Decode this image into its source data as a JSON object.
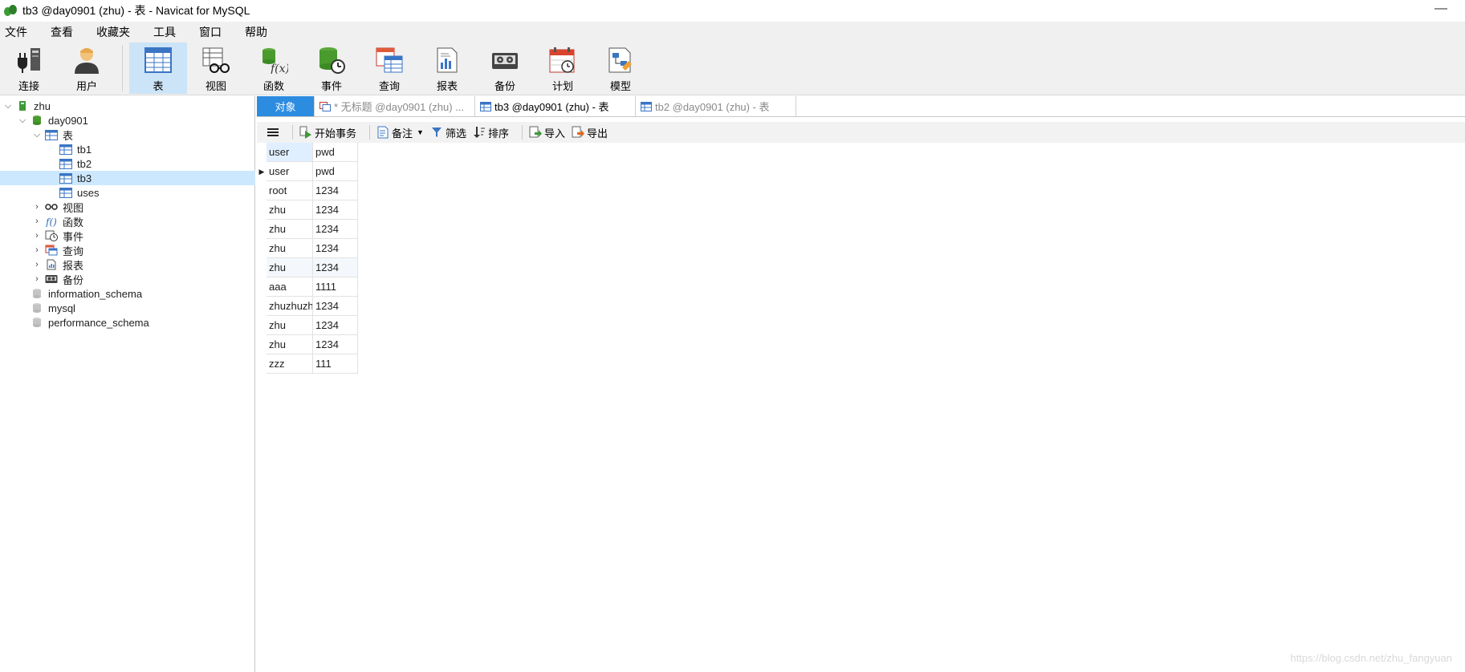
{
  "window": {
    "title": "tb3 @day0901 (zhu) - 表 - Navicat for MySQL",
    "minimize": "—"
  },
  "menu": [
    "文件",
    "查看",
    "收藏夹",
    "工具",
    "窗口",
    "帮助"
  ],
  "toolbar": [
    {
      "label": "连接",
      "icon": "connection-plug-icon"
    },
    {
      "label": "用户",
      "icon": "user-icon"
    },
    {
      "label": "表",
      "icon": "table-icon",
      "active": true
    },
    {
      "label": "视图",
      "icon": "view-glasses-icon"
    },
    {
      "label": "函数",
      "icon": "function-icon"
    },
    {
      "label": "事件",
      "icon": "event-clock-icon"
    },
    {
      "label": "查询",
      "icon": "query-icon"
    },
    {
      "label": "报表",
      "icon": "report-icon"
    },
    {
      "label": "备份",
      "icon": "backup-icon"
    },
    {
      "label": "计划",
      "icon": "schedule-calendar-icon"
    },
    {
      "label": "模型",
      "icon": "model-icon"
    }
  ],
  "tree": [
    {
      "label": "zhu",
      "level": 0,
      "arrow": "⌵",
      "icon": "connection-icon"
    },
    {
      "label": "day0901",
      "level": 1,
      "arrow": "⌵",
      "icon": "database-icon"
    },
    {
      "label": "表",
      "level": 2,
      "arrow": "⌵",
      "icon": "table-icon"
    },
    {
      "label": "tb1",
      "level": 3,
      "arrow": "",
      "icon": "table-icon"
    },
    {
      "label": "tb2",
      "level": 3,
      "arrow": "",
      "icon": "table-icon"
    },
    {
      "label": "tb3",
      "level": 3,
      "arrow": "",
      "icon": "table-icon",
      "selected": true
    },
    {
      "label": "uses",
      "level": 3,
      "arrow": "",
      "icon": "table-icon"
    },
    {
      "label": "视图",
      "level": 2,
      "arrow": "›",
      "icon": "view-glasses-icon"
    },
    {
      "label": "函数",
      "level": 2,
      "arrow": "›",
      "icon": "function-icon"
    },
    {
      "label": "事件",
      "level": 2,
      "arrow": "›",
      "icon": "event-clock-icon"
    },
    {
      "label": "查询",
      "level": 2,
      "arrow": "›",
      "icon": "query-icon"
    },
    {
      "label": "报表",
      "level": 2,
      "arrow": "›",
      "icon": "report-icon"
    },
    {
      "label": "备份",
      "level": 2,
      "arrow": "›",
      "icon": "backup-icon"
    },
    {
      "label": "information_schema",
      "level": 1,
      "arrow": "",
      "icon": "database-gray-icon"
    },
    {
      "label": "mysql",
      "level": 1,
      "arrow": "",
      "icon": "database-gray-icon"
    },
    {
      "label": "performance_schema",
      "level": 1,
      "arrow": "",
      "icon": "database-gray-icon"
    }
  ],
  "tabs": {
    "objects": "对象",
    "items": [
      {
        "label": "* 无标题 @day0901 (zhu) ...",
        "state": "inactive",
        "icon": "query-icon"
      },
      {
        "label": "tb3 @day0901 (zhu) - 表",
        "state": "current",
        "icon": "table-icon"
      },
      {
        "label": "tb2 @day0901 (zhu) - 表",
        "state": "inactive",
        "icon": "table-icon"
      }
    ]
  },
  "subtoolbar": {
    "menu_icon": "hamburger-menu-icon",
    "begin_transaction": "开始事务",
    "memo": "备注",
    "filter": "筛选",
    "sort": "排序",
    "import": "导入",
    "export": "导出"
  },
  "grid": {
    "columns": [
      "user",
      "pwd"
    ],
    "rows": [
      [
        "user",
        "pwd"
      ],
      [
        "root",
        "1234"
      ],
      [
        "zhu",
        "1234"
      ],
      [
        "zhu",
        "1234"
      ],
      [
        "zhu",
        "1234"
      ],
      [
        "zhu",
        "1234"
      ],
      [
        "aaa",
        "1111"
      ],
      [
        "zhuzhuzhu",
        "1234"
      ],
      [
        "zhu",
        "1234"
      ],
      [
        "zhu",
        "1234"
      ],
      [
        "zzz",
        "111"
      ]
    ]
  },
  "watermark": "https://blog.csdn.net/zhu_fangyuan",
  "colors": {
    "accent": "#2c8ce0",
    "selected": "#cce8ff",
    "toolbar_active": "#cce4f7"
  }
}
